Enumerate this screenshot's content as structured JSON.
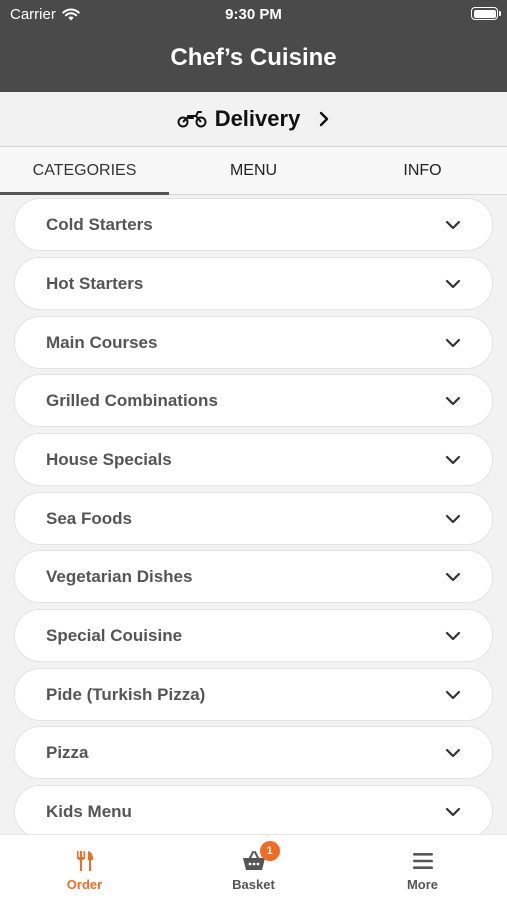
{
  "status_bar": {
    "carrier": "Carrier",
    "time": "9:30 PM",
    "wifi_icon": "wifi-icon",
    "battery_icon": "battery-icon"
  },
  "header": {
    "title": "Chef’s Cuisine"
  },
  "delivery": {
    "label": "Delivery",
    "icon": "motorbike-icon",
    "chevron_icon": "chevron-right-icon"
  },
  "tabs": [
    {
      "label": "CATEGORIES",
      "active": true
    },
    {
      "label": "MENU",
      "active": false
    },
    {
      "label": "INFO",
      "active": false
    }
  ],
  "categories": [
    {
      "label": "Cold Starters"
    },
    {
      "label": "Hot Starters"
    },
    {
      "label": "Main Courses"
    },
    {
      "label": "Grilled Combinations"
    },
    {
      "label": "House Specials"
    },
    {
      "label": "Sea Foods"
    },
    {
      "label": "Vegetarian Dishes"
    },
    {
      "label": "Special Couisine"
    },
    {
      "label": "Pide (Turkish Pizza)"
    },
    {
      "label": "Pizza"
    },
    {
      "label": "Kids Menu"
    }
  ],
  "bottom_nav": {
    "order": {
      "label": "Order",
      "icon": "fork-knife-icon",
      "active": true
    },
    "basket": {
      "label": "Basket",
      "icon": "basket-icon",
      "badge": "1"
    },
    "more": {
      "label": "More",
      "icon": "hamburger-menu-icon"
    }
  },
  "colors": {
    "header_bg": "#4a4a4a",
    "accent": "#f26b22",
    "page_bg": "#f2f2f2"
  }
}
